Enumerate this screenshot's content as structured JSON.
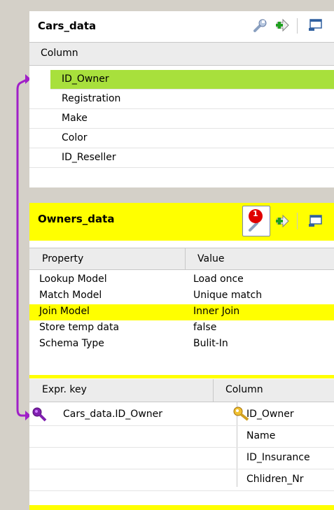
{
  "cars_panel": {
    "title": "Cars_data",
    "column_header": "Column",
    "rows": [
      "ID_Owner",
      "Registration",
      "Make",
      "Color",
      "ID_Reseller"
    ],
    "selected_row": "ID_Owner"
  },
  "owners_panel": {
    "title": "Owners_data",
    "warning_badge": "1",
    "properties": {
      "headers": [
        "Property",
        "Value"
      ],
      "rows": [
        [
          "Lookup Model",
          "Load once"
        ],
        [
          "Match Model",
          "Unique match"
        ],
        [
          "Join Model",
          "Inner Join"
        ],
        [
          "Store temp data",
          "false"
        ],
        [
          "Schema Type",
          "Bulit-In"
        ]
      ],
      "highlighted_row": "Join Model"
    },
    "keys": {
      "headers": [
        "Expr. key",
        "Column"
      ],
      "expr_key": "Cars_data.ID_Owner",
      "columns": [
        "ID_Owner",
        "Name",
        "ID_Insurance",
        "Chlidren_Nr"
      ]
    }
  },
  "colors": {
    "selection_green": "#a8e03c",
    "highlight_yellow": "#ffff00",
    "link_purple": "#a020c8",
    "background": "#d4d0c8"
  },
  "icons": [
    "wrench-icon",
    "add-arrow-icon",
    "window-icon",
    "key-purple-icon",
    "key-gold-icon",
    "warning-badge-icon"
  ]
}
